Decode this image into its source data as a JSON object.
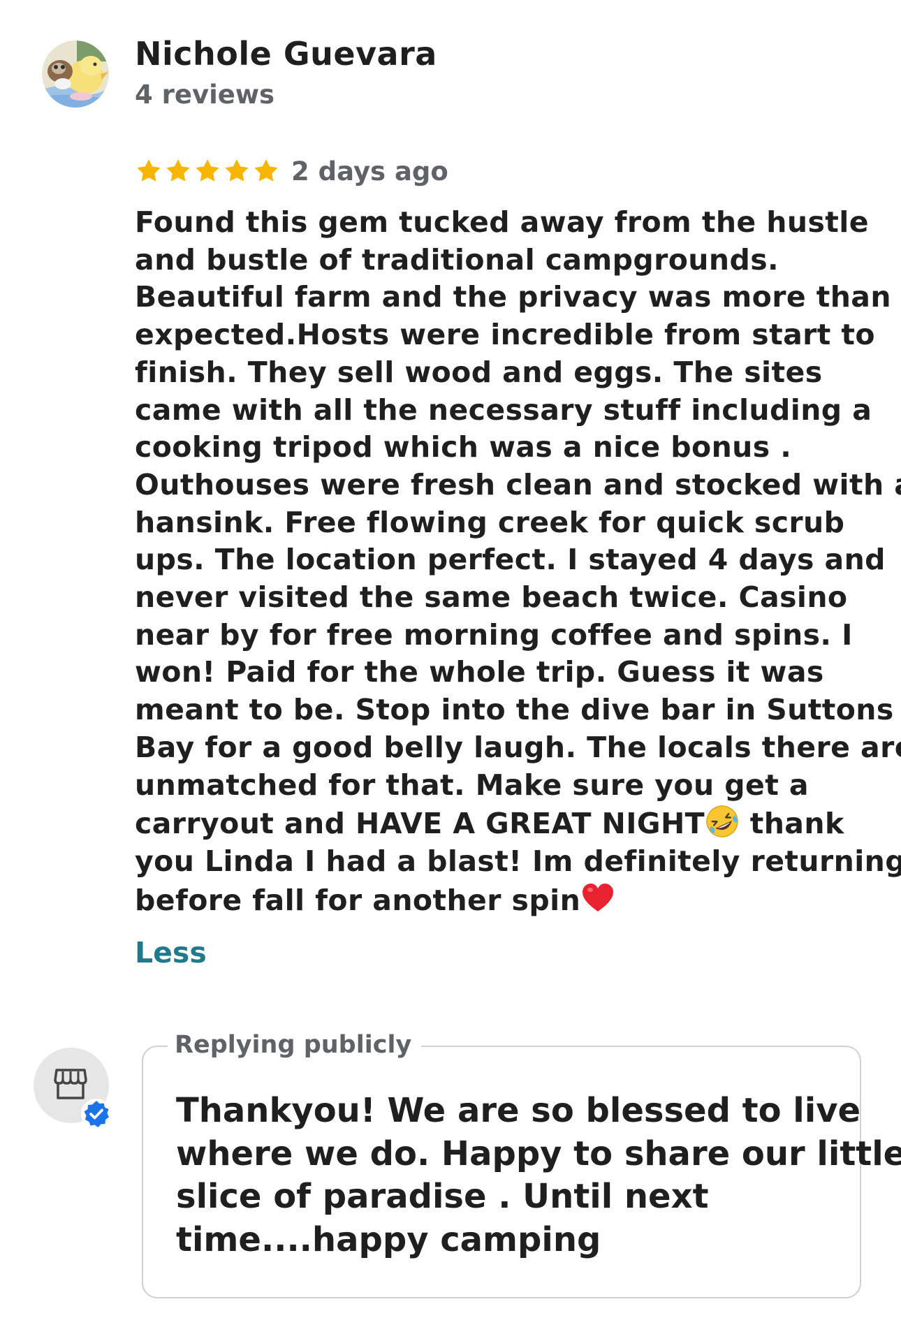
{
  "review": {
    "author": {
      "name": "Nichole Guevara",
      "meta": "4 reviews",
      "avatar_icon": "chick-avatar-icon"
    },
    "rating": 5,
    "rating_max": 5,
    "star_color": "#f7b500",
    "date": "2 days ago",
    "text_lines": [
      "Found this gem tucked away from the hustle",
      "and bustle of traditional campgrounds.",
      "Beautiful farm and the privacy was more than",
      "expected.Hosts were incredible from start to",
      "finish. They sell wood and eggs. The sites",
      "came with all the necessary stuff including a",
      "cooking tripod which was a nice bonus .",
      "Outhouses were fresh clean and stocked with a",
      "hansink. Free flowing creek for quick scrub",
      "ups. The location perfect. I  stayed 4 days and",
      "never visited the same beach twice. Casino",
      "near by for free morning coffee and spins. I",
      "won! Paid for the whole trip. Guess it was",
      "meant to be. Stop into the dive bar in Suttons",
      "Bay for a good belly laugh. The locals there are",
      "unmatched for that. Make sure you get a"
    ],
    "line_16_before": "carryout and HAVE A GREAT NIGHT",
    "line_16_after": " thank",
    "line_17": "you Linda I had a blast! Im definitely returning",
    "line_18": "before fall for another spin",
    "emoji_laugh": "rolling-on-floor-laughing-emoji",
    "emoji_heart": "red-heart-emoji",
    "less_label": "Less",
    "link_color": "#1f7a8c"
  },
  "reply": {
    "owner_icon": "storefront-icon",
    "badge_icon": "verified-check-icon",
    "badge_color": "#1a73e8",
    "legend": "Replying publicly",
    "text_lines": [
      "Thankyou! We are so blessed to live",
      "where we do. Happy to share our little",
      "slice of paradise . Until next",
      "time....happy camping"
    ]
  }
}
